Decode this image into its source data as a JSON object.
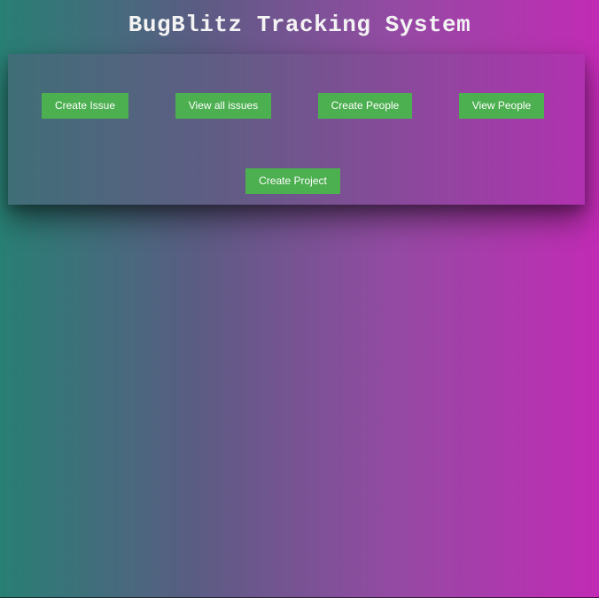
{
  "header": {
    "title": "BugBlitz Tracking System"
  },
  "nav": {
    "create_issue": "Create Issue",
    "view_all_issues": "View all issues",
    "create_people": "Create People",
    "view_people": "View People",
    "create_project": "Create Project"
  },
  "colors": {
    "button_background": "#4caf50",
    "button_text": "#ffffff",
    "gradient_start": "#287f74",
    "gradient_end": "#c12bb5",
    "title_text": "#f3f3f3"
  }
}
